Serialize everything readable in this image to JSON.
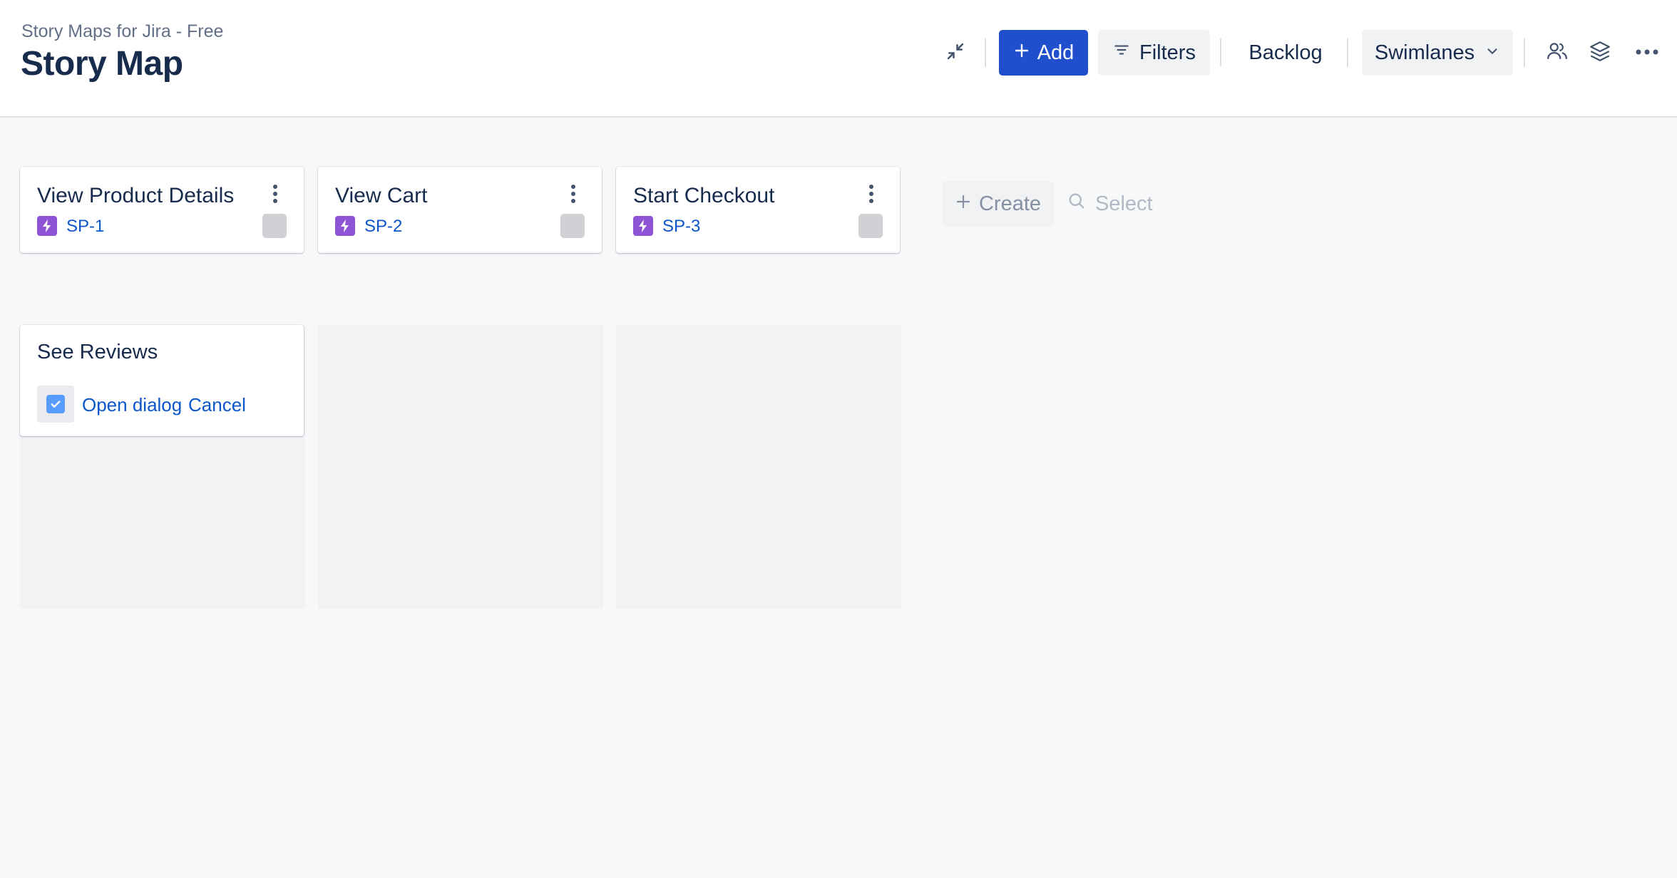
{
  "header": {
    "app_name": "Story Maps for Jira - Free",
    "title": "Story Map"
  },
  "toolbar": {
    "collapse_icon": "collapse-icon",
    "add_label": "Add",
    "filters_label": "Filters",
    "backlog_label": "Backlog",
    "swimlanes_label": "Swimlanes",
    "people_icon": "people-icon",
    "layers_icon": "layers-icon",
    "more_icon": "more-horizontal-icon"
  },
  "activities": [
    {
      "title": "View Product Details",
      "key": "SP-1"
    },
    {
      "title": "View Cart",
      "key": "SP-2"
    },
    {
      "title": "Start Checkout",
      "key": "SP-3"
    }
  ],
  "actions": {
    "create_label": "Create",
    "select_label": "Select"
  },
  "story_card": {
    "title": "See Reviews",
    "checked": true,
    "open_dialog_label": "Open dialog",
    "cancel_label": "Cancel"
  },
  "colors": {
    "primary": "#1f4fcc",
    "epic": "#8f53d6",
    "link": "#0c55cc",
    "checkbox": "#579dff"
  }
}
